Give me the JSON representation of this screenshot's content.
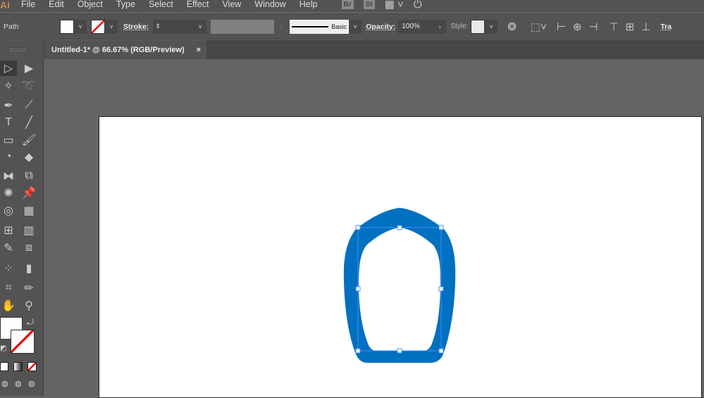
{
  "app": {
    "logo": "Ai",
    "menu": [
      "File",
      "Edit",
      "Object",
      "Type",
      "Select",
      "Effect",
      "View",
      "Window",
      "Help"
    ],
    "badges": [
      "Br",
      "St"
    ]
  },
  "control": {
    "selection_type": "Path",
    "stroke_label": "Stroke:",
    "brush_label": "Basic",
    "opacity_label": "Opacity:",
    "opacity_value": "100%",
    "style_label": "Style:",
    "transform_label": "Tra"
  },
  "tab": {
    "title": "Untitled-1* @ 66.67% (RGB/Preview)",
    "close": "×"
  },
  "tools": [
    {
      "name": "selection-tool",
      "glyph": "▷"
    },
    {
      "name": "direct-selection-tool",
      "glyph": "▶"
    },
    {
      "name": "magic-wand-tool",
      "glyph": "✧"
    },
    {
      "name": "lasso-tool",
      "glyph": "➰"
    },
    {
      "name": "pen-tool",
      "glyph": "✒"
    },
    {
      "name": "curvature-tool",
      "glyph": "⟋"
    },
    {
      "name": "type-tool",
      "glyph": "T"
    },
    {
      "name": "line-tool",
      "glyph": "╱"
    },
    {
      "name": "rectangle-tool",
      "glyph": "▭"
    },
    {
      "name": "paintbrush-tool",
      "glyph": "🖌"
    },
    {
      "name": "shaper-tool",
      "glyph": "◔"
    },
    {
      "name": "eraser-tool",
      "glyph": "◆"
    },
    {
      "name": "reflect-tool",
      "glyph": "⧓"
    },
    {
      "name": "scale-tool",
      "glyph": "⧉"
    },
    {
      "name": "puppet-warp-tool",
      "glyph": "✺"
    },
    {
      "name": "pin-tool",
      "glyph": "📌"
    },
    {
      "name": "shape-builder-tool",
      "glyph": "◎"
    },
    {
      "name": "perspective-grid-tool",
      "glyph": "▦"
    },
    {
      "name": "mesh-tool",
      "glyph": "⊞"
    },
    {
      "name": "gradient-tool",
      "glyph": "▥"
    },
    {
      "name": "eyedropper-tool",
      "glyph": "✎"
    },
    {
      "name": "blend-tool",
      "glyph": "⧈"
    },
    {
      "name": "symbol-sprayer-tool",
      "glyph": "⁘"
    },
    {
      "name": "column-graph-tool",
      "glyph": "▮"
    },
    {
      "name": "artboard-tool",
      "glyph": "⌗"
    },
    {
      "name": "slice-tool",
      "glyph": "✏"
    },
    {
      "name": "hand-tool",
      "glyph": "✋"
    },
    {
      "name": "zoom-tool",
      "glyph": "⚲"
    }
  ],
  "colors": {
    "shape_fill": "#0070c0",
    "selection": "#4a8cff",
    "ui_bg": "#535353",
    "canvas": "#646464"
  }
}
